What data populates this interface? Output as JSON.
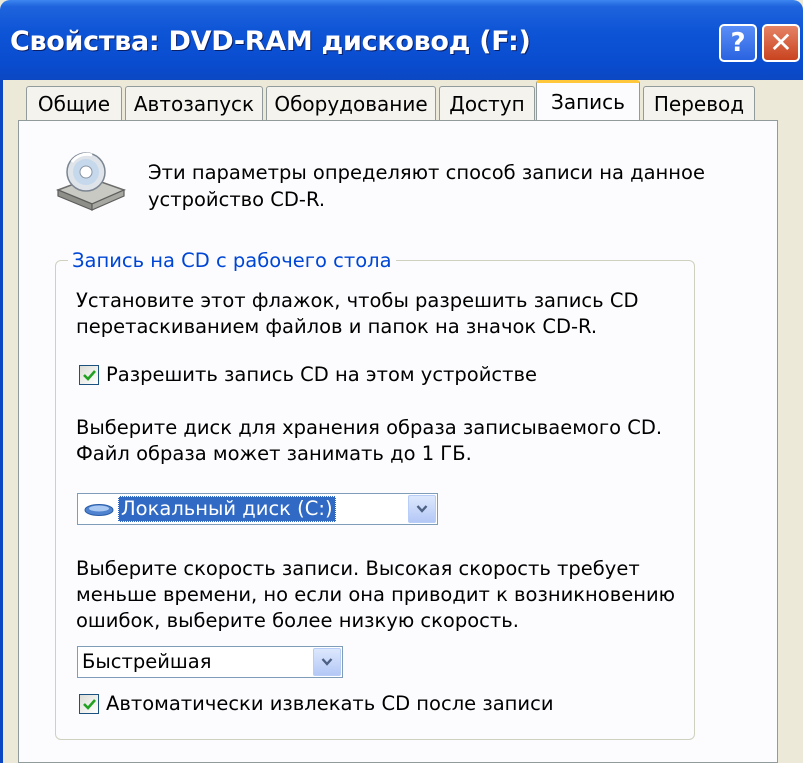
{
  "window": {
    "title": "Свойства: DVD-RAM дисковод (F:)",
    "help_label": "?",
    "close_label": "✕"
  },
  "tabs": [
    {
      "label": "Общие",
      "active": false
    },
    {
      "label": "Автозапуск",
      "active": false
    },
    {
      "label": "Оборудование",
      "active": false
    },
    {
      "label": "Доступ",
      "active": false
    },
    {
      "label": "Запись",
      "active": true
    },
    {
      "label": "Перевод",
      "active": false
    }
  ],
  "header": {
    "icon": "cd-drive-icon",
    "description_line1": "Эти параметры определяют способ записи на данное",
    "description_line2": "устройство CD-R."
  },
  "group": {
    "title": "Запись на CD с рабочего стола",
    "intro_line1": "Установите этот флажок, чтобы разрешить запись CD",
    "intro_line2": "перетаскиванием файлов и папок на значок CD-R.",
    "enable_checkbox": {
      "label": "Разрешить запись CD на этом устройстве",
      "checked": true
    },
    "disk_prompt_line1": "Выберите диск для хранения образа записываемого CD.",
    "disk_prompt_line2": "Файл образа может занимать до 1 ГБ.",
    "disk_select": {
      "value": "Локальный диск (C:)",
      "icon": "hard-disk-icon"
    },
    "speed_prompt_line1": "Выберите скорость записи. Высокая скорость требует",
    "speed_prompt_line2": "меньше времени, но если она приводит к возникновению",
    "speed_prompt_line3": "ошибок, выберите более низкую скорость.",
    "speed_select": {
      "value": "Быстрейшая"
    },
    "eject_checkbox": {
      "label": "Автоматически извлекать CD после записи",
      "checked": true
    }
  },
  "colors": {
    "titlebar": "#0a4ccf",
    "window_bg": "#ece9d8",
    "page_bg": "#fcfcfe",
    "group_title": "#0046d5",
    "selection": "#316ac5",
    "check": "#21a121",
    "active_tab_accent": "#ffc83c"
  }
}
